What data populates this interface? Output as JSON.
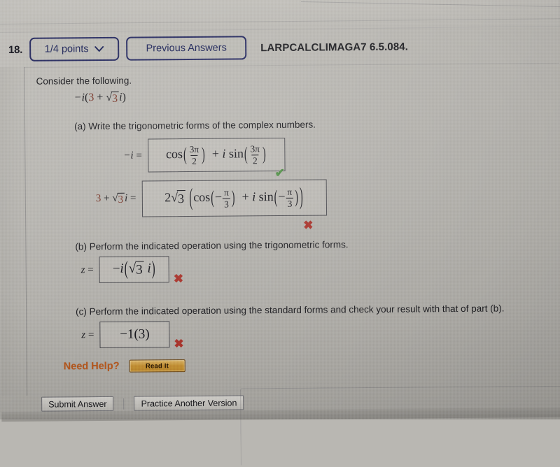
{
  "header": {
    "problem_number": "18.",
    "points_label": "1/4 points",
    "points_chevron": "chevron-down-icon",
    "previous_answers_label": "Previous Answers",
    "problem_code": "LARPCALCLIMAGA7 6.5.084."
  },
  "body": {
    "intro": "Consider the following.",
    "expression": "−i(3 + √3 i)",
    "expression_parts": {
      "prefix": "−",
      "i": "i",
      "open": "(",
      "three": "3",
      "plus": "+",
      "radicand": "3",
      "i2": "i",
      "close": ")"
    },
    "part_a": {
      "label": "(a) Write the trigonometric forms of the complex numbers.",
      "rows": [
        {
          "lhs": "−i =",
          "answer": "cos(3π/2) + i sin(3π/2)",
          "answer_tokens": {
            "cos": "cos",
            "num": "3π",
            "den": "2",
            "plus": "+",
            "i": "i",
            "sin": "sin",
            "num2": "3π",
            "den2": "2"
          },
          "mark": "check",
          "mark_glyph": "✔"
        },
        {
          "lhs": "3 + √3i =",
          "answer": "2√3 (cos(−π/3) + i sin(−π/3))",
          "answer_tokens": {
            "coef": "2",
            "radicand": "3",
            "cos": "cos",
            "minus": "−",
            "num": "π",
            "den": "3",
            "plus": "+",
            "i": "i",
            "sin": "sin",
            "minus2": "−",
            "num2": "π",
            "den2": "3"
          },
          "mark": "cross",
          "mark_glyph": "✖"
        }
      ]
    },
    "part_b": {
      "label": "(b) Perform the indicated operation using the trigonometric forms.",
      "lhs": "z =",
      "answer": "−i(√3 i)",
      "answer_tokens": {
        "minus": "−",
        "i": "i",
        "radicand": "3",
        "i2": "i"
      },
      "mark": "cross",
      "mark_glyph": "✖"
    },
    "part_c": {
      "label": "(c) Perform the indicated operation using the standard forms and check your result with that of part (b).",
      "lhs": "z =",
      "answer": "−1(3)",
      "mark": "cross",
      "mark_glyph": "✖"
    }
  },
  "help": {
    "need_help_label": "Need Help?",
    "read_it_label": "Read It"
  },
  "footer": {
    "submit_label": "Submit Answer",
    "practice_label": "Practice Another Version"
  },
  "colors": {
    "pill_border": "#2b2f63",
    "pill_text": "#232a5c",
    "cross_red": "#a8342c",
    "check_green": "#4d8c43",
    "need_help_orange": "#b4581f",
    "read_it_bg": "#c28f34",
    "page_bg": "#b6b4af",
    "math_red": "#7a3a2d"
  }
}
